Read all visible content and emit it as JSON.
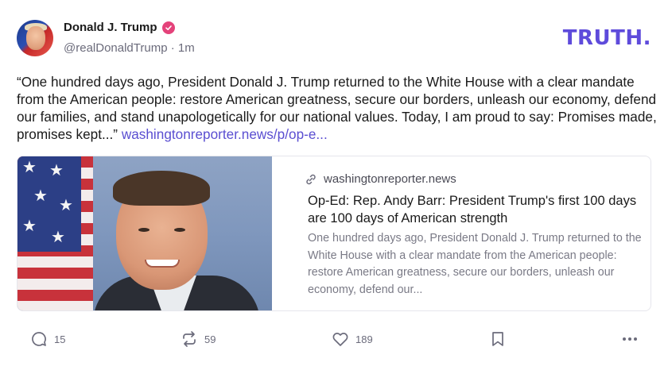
{
  "author": {
    "display_name": "Donald J. Trump",
    "handle": "@realDonaldTrump",
    "separator": "·",
    "time_ago": "1m",
    "verified_icon": "verified-badge-icon"
  },
  "brand": {
    "logo_text": "TRUTH.",
    "color": "#5e4bdb"
  },
  "post": {
    "text": "“One hundred days ago, President Donald J. Trump returned to the White House with a clear mandate from the American people: restore American greatness, secure our borders, unleash our economy, defend our families, and stand unapologetically for our national values. Today, I am proud to say: Promises made, promises kept...” ",
    "link_text": "washingtonreporter.news/p/op-e..."
  },
  "link_card": {
    "domain": "washingtonreporter.news",
    "title": "Op-Ed: Rep. Andy Barr: President Trump's first 100 days are 100 days of American strength",
    "description": "One hundred days ago, President Donald J. Trump returned to the White House with a clear mandate from the American people: restore American greatness, secure our borders, unleash our economy, defend our..."
  },
  "actions": {
    "replies": "15",
    "retruths": "59",
    "likes": "189"
  },
  "colors": {
    "accent": "#5a4ed1",
    "verified": "#e4427a",
    "muted": "#6b6b7b"
  }
}
